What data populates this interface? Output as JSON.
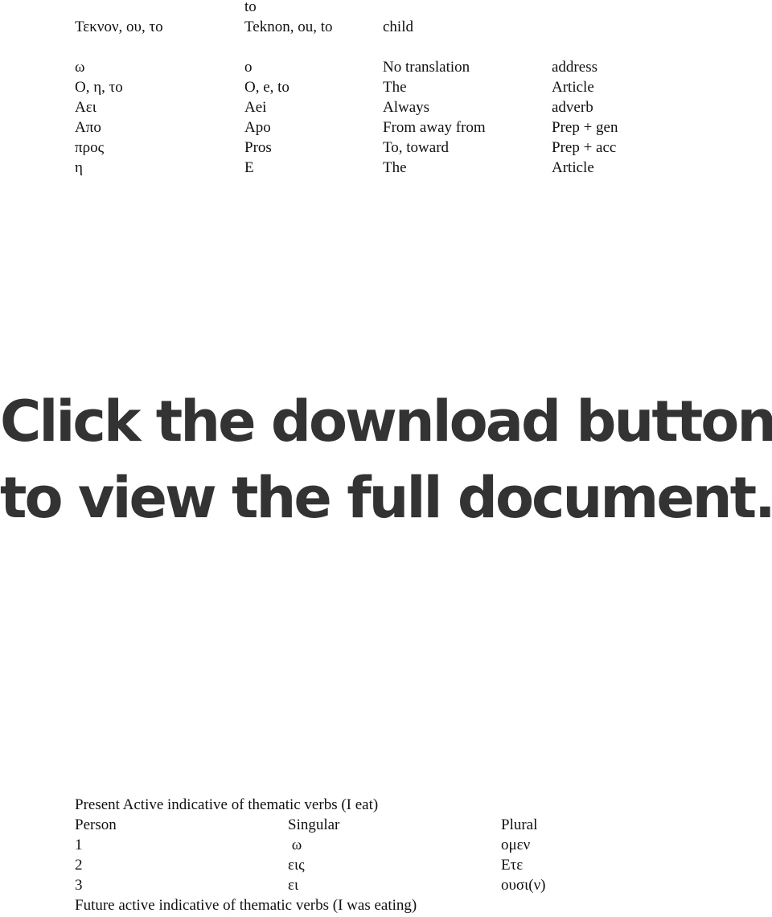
{
  "vocab": {
    "top_fragment": "to",
    "rows": [
      [
        "Τεκνον, ου, το",
        "Teknon, ou, to",
        "child",
        ""
      ],
      [
        "ω",
        "o",
        "No translation",
        "address"
      ],
      [
        "Ο, η, το",
        "O, e, to",
        "The",
        "Article"
      ],
      [
        "Αει",
        "Aei",
        "Always",
        "adverb"
      ],
      [
        "Απο",
        "Apo",
        "From away from",
        "Prep + gen"
      ],
      [
        "προς",
        "Pros",
        "To, toward",
        "Prep + acc"
      ],
      [
        "η",
        "E",
        "The",
        "Article"
      ]
    ]
  },
  "overlay": {
    "line1": "Click the download button",
    "line2": "to view the full document."
  },
  "conjugation": {
    "title": "Present Active indicative of thematic verbs (I eat)",
    "headers": [
      "Person",
      "Singular",
      "Plural"
    ],
    "rows": [
      [
        "1",
        " ω",
        "ομεν"
      ],
      [
        "2",
        "εις",
        "Ετε"
      ],
      [
        "3",
        "ει",
        "ουσι(ν)"
      ]
    ],
    "next_title": "Future active indicative of thematic verbs (I was eating)"
  }
}
